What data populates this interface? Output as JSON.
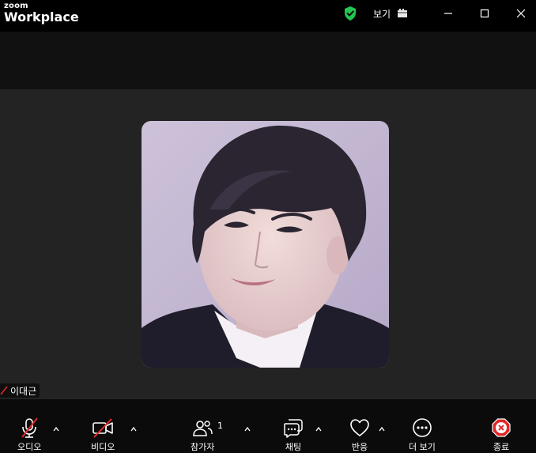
{
  "app": {
    "logo_small": "zoom",
    "logo_large": "Workplace"
  },
  "titlebar": {
    "view_label": "보기",
    "shield_icon": "shield-check-icon",
    "shield_color": "#23c552"
  },
  "participant": {
    "name": "이대근",
    "muted_icon": "mic-muted-icon"
  },
  "toolbar": {
    "audio_label": "오디오",
    "video_label": "비디오",
    "participants_label": "참가자",
    "participants_count": "1",
    "chat_label": "채팅",
    "reactions_label": "반응",
    "more_label": "더 보기",
    "end_label": "종료",
    "end_color": "#e02828",
    "muted_color": "#e02828"
  }
}
